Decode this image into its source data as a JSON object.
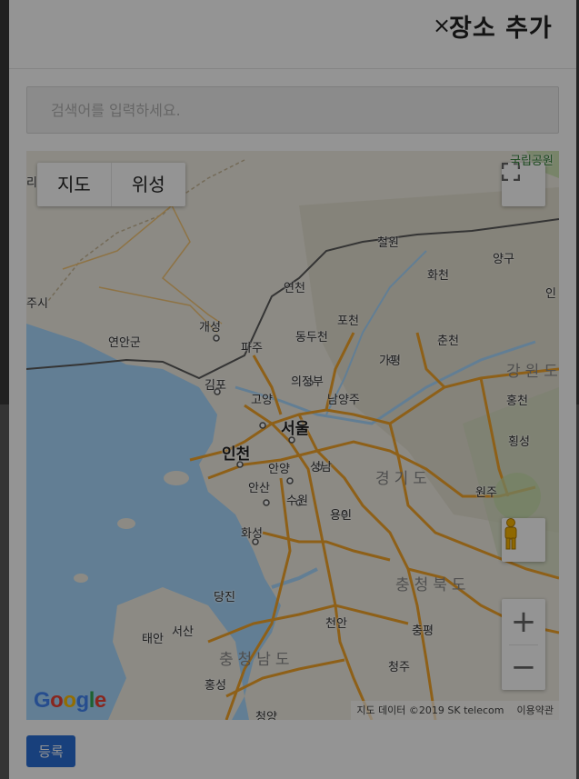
{
  "dialog": {
    "close_label": "×",
    "title": "장소 추가"
  },
  "search": {
    "placeholder": "검색어를 입력하세요.",
    "value": ""
  },
  "map": {
    "map_type_options": [
      "지도",
      "위성"
    ],
    "selected_map_type": "지도",
    "zoom_in_label": "+",
    "zoom_out_label": "−",
    "google_logo": "Google",
    "attribution": "지도 데이터 ©2019 SK telecom",
    "terms_link": "이용약관",
    "places": [
      "국립공원",
      "리",
      "철원",
      "양구",
      "화천",
      "연천",
      "인",
      "주시",
      "개성",
      "연안군",
      "파주",
      "동두천",
      "포천",
      "춘천",
      "가평",
      "김포",
      "의정부",
      "강원도",
      "남양주",
      "고양",
      "홍천",
      "서울",
      "인천",
      "횡성",
      "안양",
      "성남",
      "경기도",
      "안산",
      "수원",
      "원주",
      "용인",
      "화성",
      "충청북도",
      "당진",
      "천안",
      "서산",
      "태안",
      "충청남도",
      "충평",
      "청주",
      "홍성",
      "청양"
    ],
    "colors": {
      "water": "#aadaff",
      "land": "#f1eee4",
      "highway": "#f4a52a",
      "border": "#5a5a5a"
    }
  },
  "footer": {
    "register_label": "등록"
  },
  "overlay": {
    "color": "#000000",
    "opacity": 0.42
  }
}
